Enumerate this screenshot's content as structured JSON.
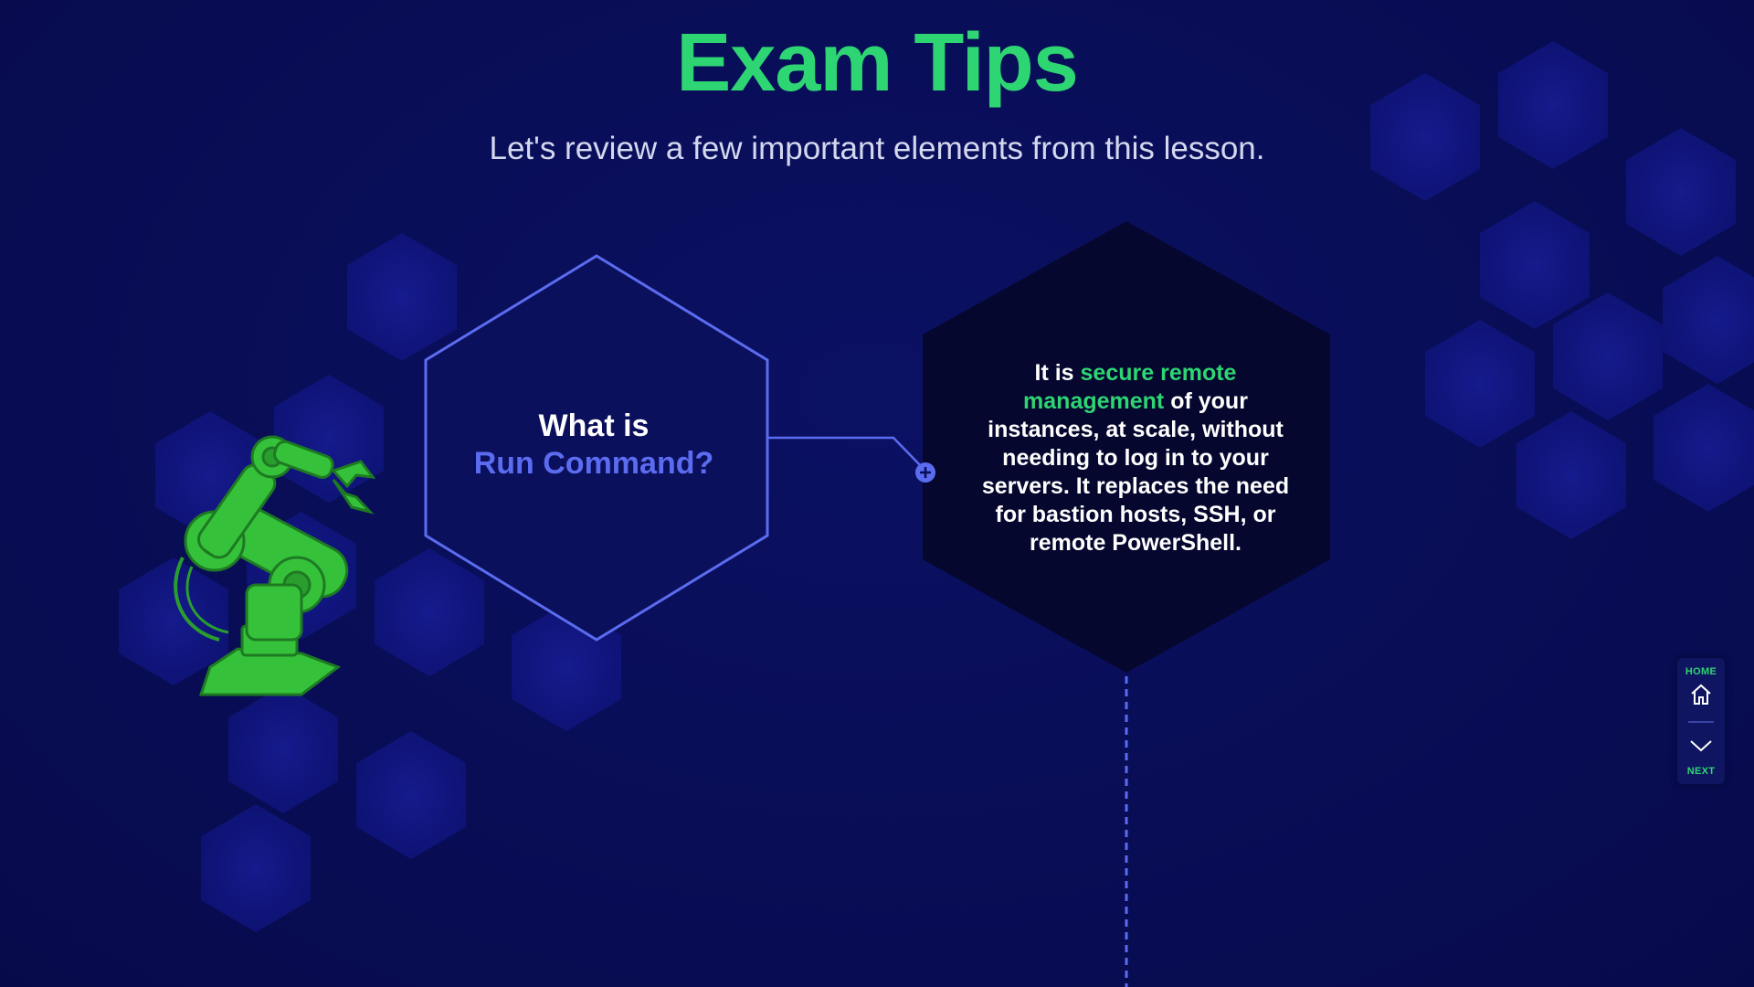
{
  "header": {
    "title": "Exam Tips",
    "subtitle": "Let's review a few important elements from this lesson."
  },
  "question": {
    "line1": "What is",
    "line2": "Run Command?"
  },
  "answer": {
    "prefix": "It is ",
    "highlight": "secure remote management",
    "body": " of your instances, at scale, without needing to log in to your servers. It replaces the need for bastion hosts, SSH, or remote PowerShell."
  },
  "nav": {
    "home_label": "HOME",
    "next_label": "NEXT"
  },
  "icons": {
    "expand": "plus-circle-icon",
    "home": "home-icon",
    "next": "chevron-down-icon",
    "robot": "robot-arm-icon"
  },
  "colors": {
    "background": "#080c52",
    "accent_green": "#2ed573",
    "accent_blue": "#5b6cf0",
    "answer_hex_fill": "#05072e"
  }
}
